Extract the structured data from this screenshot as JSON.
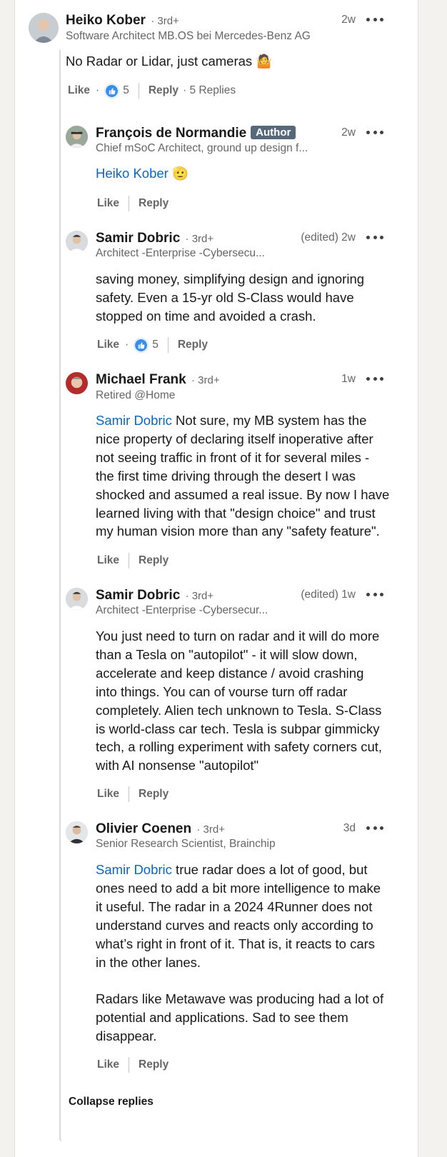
{
  "comments": [
    {
      "name": "Heiko Kober",
      "degree": "· 3rd+",
      "headline": "Software Architect MB.OS bei Mercedes-Benz AG",
      "time": "2w",
      "body": "No Radar or Lidar, just cameras 🤷",
      "mention": "",
      "actions": {
        "like": "Like",
        "reactions": "5",
        "reply": "Reply",
        "replies": "· 5 Replies"
      }
    },
    {
      "name": "François de Normandie",
      "badge": "Author",
      "headline": "Chief mSoC Architect, ground up design f...",
      "time": "2w",
      "mention": "Heiko Kober",
      "body": " 🫡",
      "actions": {
        "like": "Like",
        "reply": "Reply"
      }
    },
    {
      "name": "Samir Dobric",
      "degree": "· 3rd+",
      "headline": "Architect -Enterprise -Cybersecu...",
      "time": "(edited) 2w",
      "mention": "",
      "body": "saving money, simplifying design and ignoring\nsafety. Even a 15-yr old S-Class would have\nstopped on time and avoided a crash.",
      "actions": {
        "like": "Like",
        "reactions": "5",
        "reply": "Reply"
      }
    },
    {
      "name": "Michael Frank",
      "degree": "· 3rd+",
      "headline": "Retired @Home",
      "time": "1w",
      "mention": "Samir Dobric",
      "body": " Not sure, my MB system has the\nnice property of declaring itself inoperative after\nnot seeing traffic in front of it for several miles -\nthe first time driving through the desert I was\nshocked and assumed a real issue. By now I have\nlearned living with that \"design choice\" and trust\nmy human vision more than any \"safety feature\".",
      "actions": {
        "like": "Like",
        "reply": "Reply"
      }
    },
    {
      "name": "Samir Dobric",
      "degree": "· 3rd+",
      "headline": "Architect -Enterprise -Cybersecur...",
      "time": "(edited) 1w",
      "mention": "",
      "body": "You just need to turn on radar and it will do more\nthan a Tesla on \"autopilot\" - it will slow down,\naccelerate and keep distance / avoid crashing\ninto things. You can of vourse turn off radar\ncompletely. Alien tech unknown to Tesla. S-Class\nis world-class car tech. Tesla is subpar gimmicky\ntech, a rolling experiment with safety corners cut,\nwith AI nonsense \"autopilot\"",
      "actions": {
        "like": "Like",
        "reply": "Reply"
      }
    },
    {
      "name": "Olivier Coenen",
      "degree": "· 3rd+",
      "headline": "Senior Research Scientist, Brainchip",
      "time": "3d",
      "mention": "Samir Dobric",
      "body": " true radar does a lot of good, but\nones need to add a bit more intelligence to make\nit useful. The radar in a 2024 4Runner does not\nunderstand curves and reacts only according to\nwhat’s right in front of it. That is, it reacts to cars\nin the other lanes.\n\nRadars like Metawave was producing had a lot of\npotential and applications. Sad to see them\ndisappear.",
      "actions": {
        "like": "Like",
        "reply": "Reply"
      }
    }
  ],
  "collapse_label": "Collapse replies",
  "colors": {
    "link": "#0a66c2",
    "badge": "#56687a",
    "like": "#378fe9"
  }
}
